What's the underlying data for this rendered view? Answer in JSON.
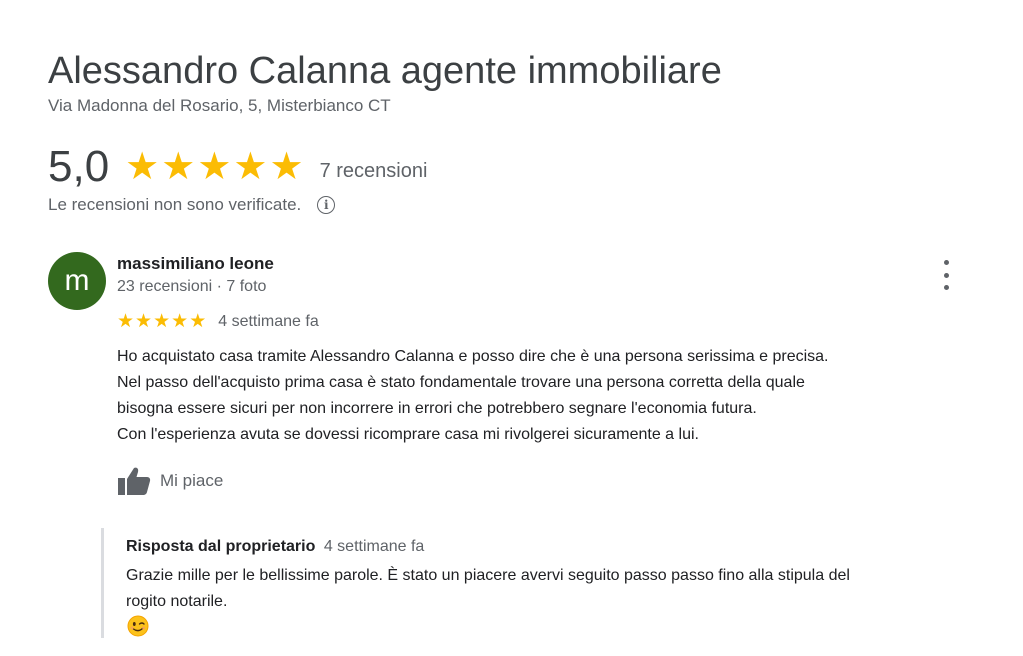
{
  "business": {
    "name": "Alessandro Calanna agente immobiliare",
    "address": "Via Madonna del Rosario, 5, Misterbianco CT"
  },
  "rating": {
    "value": "5,0",
    "stars": 5,
    "review_count_label": "7 recensioni",
    "star_color": "#fbbc04",
    "not_verified_notice": "Le recensioni non sono verificate.",
    "info_icon": "info-icon"
  },
  "review": {
    "avatar_letter": "m",
    "avatar_color": "#33691e",
    "author": "massimiliano leone",
    "author_meta": "23 recensioni · 7 foto",
    "stars": 5,
    "time": "4 settimane fa",
    "text_lines": [
      "Ho acquistato casa tramite Alessandro Calanna e posso dire che è una persona serissima e precisa.",
      "Nel passo dell'acquisto prima casa è stato fondamentale trovare una persona corretta della quale",
      "bisogna essere sicuri per non incorrere in errori che potrebbero segnare l'economia futura.",
      "Con l'esperienza avuta se dovessi ricomprare casa mi rivolgerei sicuramente a lui."
    ],
    "like_label": "Mi piace",
    "like_icon": "thumbs-up-icon",
    "more_icon": "more-vert-icon"
  },
  "owner_reply": {
    "label": "Risposta dal proprietario",
    "time": "4 settimane fa",
    "text_lines": [
      "Grazie mille per le bellissime parole. È stato un piacere avervi seguito passo passo fino alla stipula del",
      "rogito notarile."
    ],
    "emoji": "winking-face-emoji"
  }
}
